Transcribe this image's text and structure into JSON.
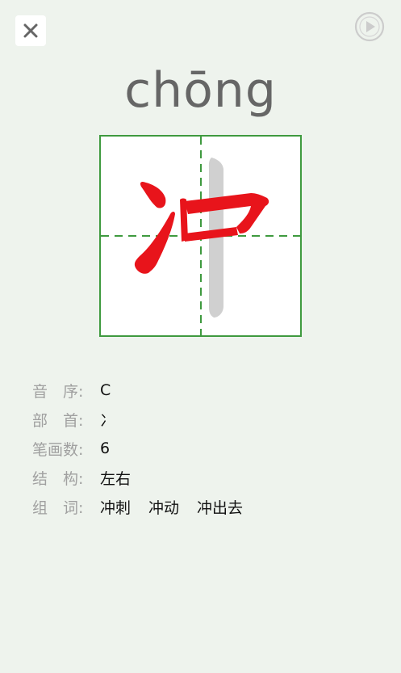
{
  "header": {
    "close_icon": "close-icon",
    "play_icon": "play-circle-icon"
  },
  "character": {
    "pinyin": "chōng",
    "glyph": "冲",
    "stroke_color_done": "#e8141b",
    "stroke_color_pending": "#d0d0d0",
    "grid_border_color": "#3f9a3f"
  },
  "info": {
    "order_label": "音　序:",
    "order_value": "C",
    "radical_label": "部　首:",
    "radical_value": "冫",
    "strokes_label": "笔画数:",
    "strokes_value": "6",
    "structure_label": "结　构:",
    "structure_value": "左右",
    "words_label": "组　词:",
    "words": [
      "冲刺",
      "冲动",
      "冲出去"
    ]
  }
}
